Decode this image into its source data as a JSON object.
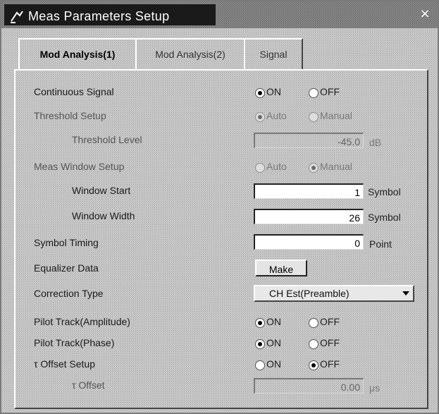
{
  "window": {
    "title": "Meas Parameters Setup",
    "close_label": "×"
  },
  "tabs": [
    {
      "label": "Mod Analysis(1)",
      "active": true
    },
    {
      "label": "Mod Analysis(2)",
      "active": false
    },
    {
      "label": "Signal",
      "active": false
    }
  ],
  "fields": {
    "continuous_signal": {
      "label": "Continuous Signal",
      "on": "ON",
      "off": "OFF",
      "selected": "ON"
    },
    "threshold_setup": {
      "label": "Threshold Setup",
      "auto": "Auto",
      "manual": "Manual",
      "selected": "Auto",
      "enabled": false
    },
    "threshold_level": {
      "label": "Threshold Level",
      "value": "-45.0",
      "unit": "dB",
      "enabled": false
    },
    "meas_window_setup": {
      "label": "Meas Window Setup",
      "auto": "Auto",
      "manual": "Manual",
      "selected": "Manual",
      "enabled": false
    },
    "window_start": {
      "label": "Window Start",
      "value": "1",
      "unit": "Symbol"
    },
    "window_width": {
      "label": "Window Width",
      "value": "26",
      "unit": "Symbol"
    },
    "symbol_timing": {
      "label": "Symbol Timing",
      "value": "0",
      "unit": "Point"
    },
    "equalizer_data": {
      "label": "Equalizer Data",
      "button": "Make"
    },
    "correction_type": {
      "label": "Correction Type",
      "value": "CH Est(Preamble)"
    },
    "pilot_track_amplitude": {
      "label": "Pilot Track(Amplitude)",
      "on": "ON",
      "off": "OFF",
      "selected": "ON"
    },
    "pilot_track_phase": {
      "label": "Pilot Track(Phase)",
      "on": "ON",
      "off": "OFF",
      "selected": "ON"
    },
    "tau_offset_setup": {
      "label": "τ Offset Setup",
      "on": "ON",
      "off": "OFF",
      "selected": "OFF"
    },
    "tau_offset": {
      "label": "τ Offset",
      "value": "0.00",
      "unit": "μs",
      "enabled": false
    }
  }
}
